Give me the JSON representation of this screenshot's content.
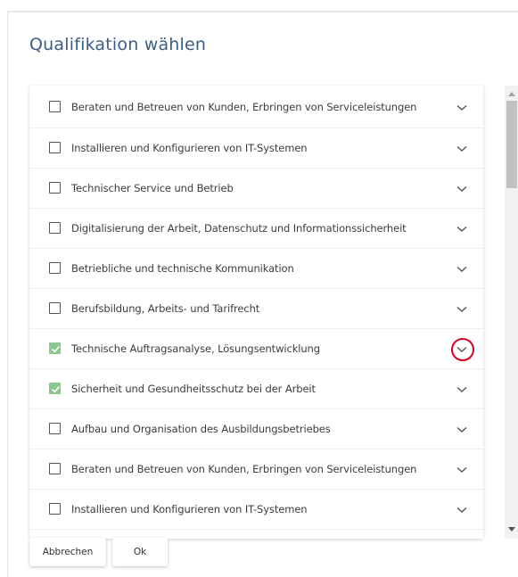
{
  "dialog": {
    "title": "Qualifikation wählen",
    "buttons": {
      "cancel": "Abbrechen",
      "ok": "Ok"
    },
    "highlight_color": "#d9001b",
    "check_color": "#8bc78e"
  },
  "list": {
    "items": [
      {
        "label": "Beraten und Betreuen von Kunden, Erbringen von Serviceleistungen",
        "checked": false
      },
      {
        "label": "Installieren und Konfigurieren von IT-Systemen",
        "checked": false
      },
      {
        "label": "Technischer Service und Betrieb",
        "checked": false
      },
      {
        "label": "Digitalisierung der Arbeit, Datenschutz und Informationssicherheit",
        "checked": false
      },
      {
        "label": "Betriebliche und technische Kommunikation",
        "checked": false
      },
      {
        "label": "Berufsbildung, Arbeits- und Tarifrecht",
        "checked": false
      },
      {
        "label": "Technische Auftragsanalyse, Lösungsentwicklung",
        "checked": true,
        "expander_highlighted": true
      },
      {
        "label": "Sicherheit und Gesundheitsschutz bei der Arbeit",
        "checked": true
      },
      {
        "label": "Aufbau und Organisation des Ausbildungsbetriebes",
        "checked": false
      },
      {
        "label": "Beraten und Betreuen von Kunden, Erbringen von Serviceleistungen",
        "checked": false
      },
      {
        "label": "Installieren und Konfigurieren von IT-Systemen",
        "checked": false
      }
    ]
  }
}
